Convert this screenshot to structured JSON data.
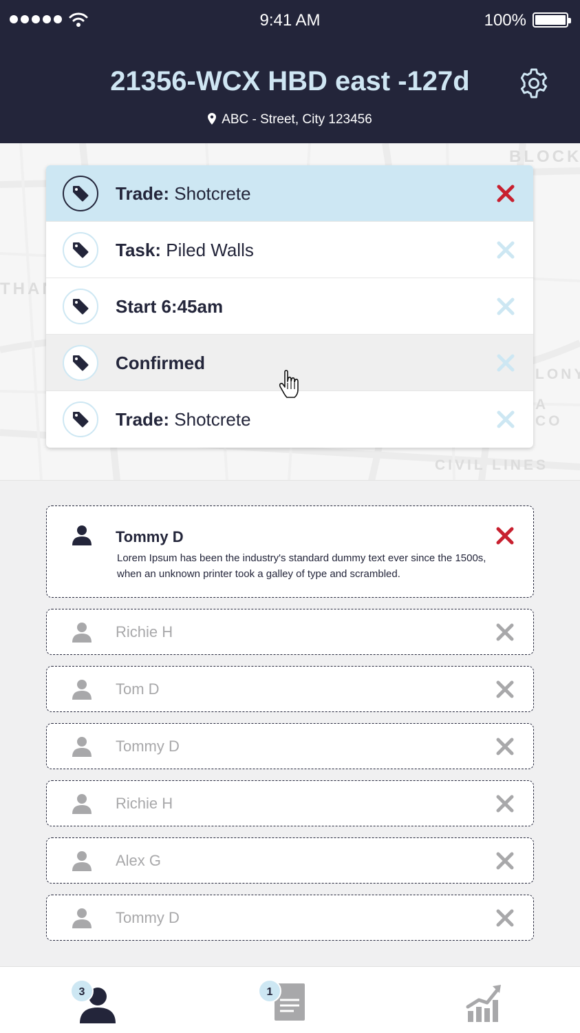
{
  "status_bar": {
    "time": "9:41 AM",
    "battery": "100%"
  },
  "header": {
    "title": "21356-WCX HBD east -127d",
    "address": "ABC - Street, City 123456"
  },
  "map": {
    "labels": [
      "BLOCK",
      "THAN",
      "CIVIL LINES",
      "LONY",
      "A CO"
    ]
  },
  "filters": [
    {
      "label": "Trade:",
      "value": "Shotcrete",
      "state": "active"
    },
    {
      "label": "Task:",
      "value": "Piled Walls",
      "state": "normal"
    },
    {
      "label": "Start 6:45am",
      "value": "",
      "state": "normal"
    },
    {
      "label": "Confirmed",
      "value": "",
      "state": "hover"
    },
    {
      "label": "Trade:",
      "value": "Shotcrete",
      "state": "normal"
    }
  ],
  "crew": {
    "main": {
      "name": "Tommy D",
      "description": "Lorem Ipsum has been the industry's standard dummy text ever since the 1500s, when an unknown printer took a galley of type and scrambled."
    },
    "others": [
      "Richie H",
      "Tom D",
      "Tommy D",
      "Richie H",
      "Alex G",
      "Tommy D"
    ]
  },
  "bottom_nav": {
    "people_badge": "3",
    "documents_badge": "1"
  },
  "colors": {
    "header_bg": "#23253a",
    "accent_light_blue": "#cde7f3",
    "remove_red": "#c8202f",
    "muted_gray": "#a8a8aa"
  },
  "icons": [
    "wifi-icon",
    "battery-icon",
    "gear-icon",
    "location-pin-icon",
    "tag-icon",
    "close-icon",
    "person-icon",
    "document-icon",
    "chart-icon",
    "hand-cursor-icon"
  ]
}
